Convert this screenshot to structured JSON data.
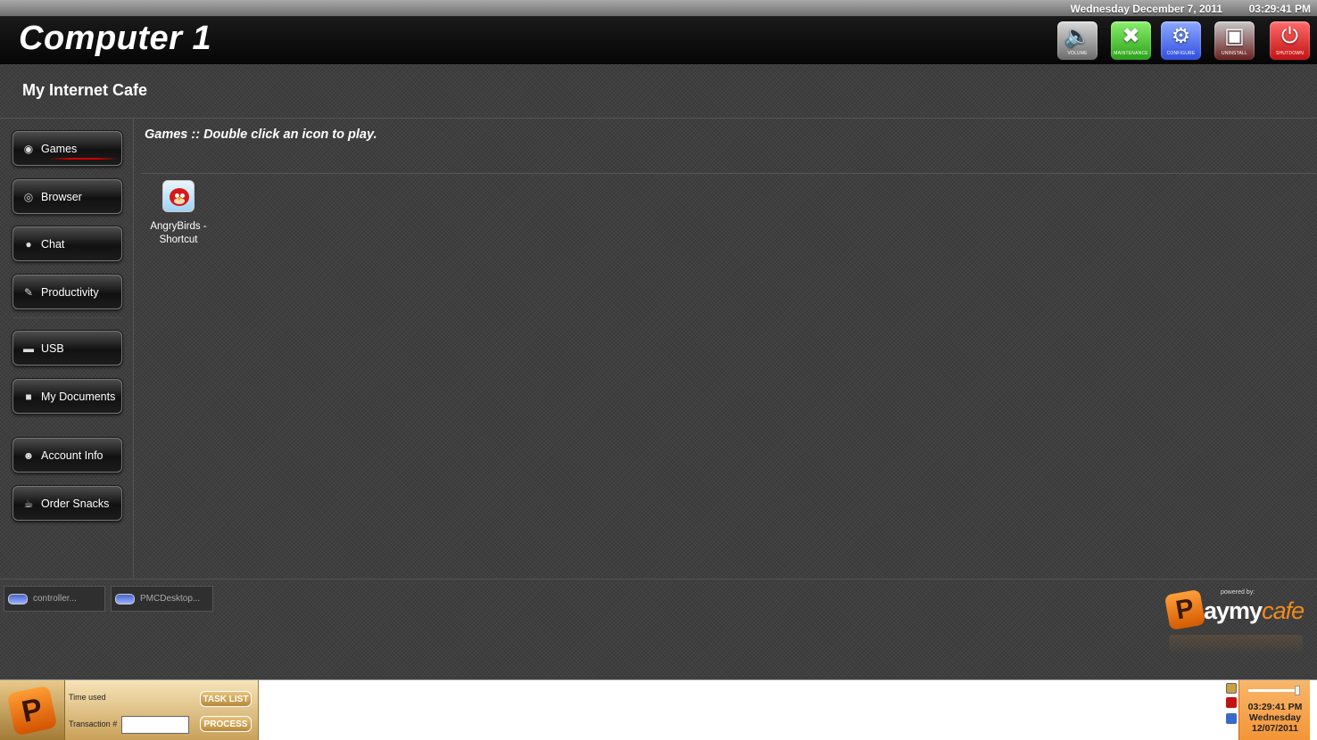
{
  "top_bar": {
    "date": "Wednesday December 7, 2011",
    "time": "03:29:41 PM"
  },
  "header": {
    "computer_name": "Computer 1",
    "tools": [
      {
        "label": "VOLUME",
        "icon": "volume-icon",
        "color": "#9a9a9a"
      },
      {
        "label": "MAINTENANCE",
        "icon": "wrench-icon",
        "color": "#3fbf2a"
      },
      {
        "label": "CONFIGURE",
        "icon": "gears-icon",
        "color": "#3a5cf0"
      },
      {
        "label": "UNINSTALL",
        "icon": "uninstall-icon",
        "color": "#8a3030"
      },
      {
        "label": "SHUTDOWN",
        "icon": "power-icon",
        "color": "#e01d1d"
      }
    ]
  },
  "cafe_name": "My Internet Cafe",
  "sidebar": {
    "items": [
      {
        "label": "Games",
        "icon": "games-icon",
        "active": true
      },
      {
        "label": "Browser",
        "icon": "globe-icon"
      },
      {
        "label": "Chat",
        "icon": "chat-bubble-icon"
      },
      {
        "label": "Productivity",
        "icon": "document-edit-icon"
      },
      {
        "label": "USB",
        "icon": "usb-drive-icon"
      },
      {
        "label": "My Documents",
        "icon": "folder-icon"
      },
      {
        "label": "Account Info",
        "icon": "user-icon"
      },
      {
        "label": "Order Snacks",
        "icon": "drink-cup-icon"
      }
    ]
  },
  "main": {
    "title": "Games :: Double click an icon to play.",
    "icons": [
      {
        "label": "AngryBirds - Shortcut",
        "icon": "angry-birds-icon"
      }
    ]
  },
  "taskbar": {
    "items": [
      {
        "label": "controller...",
        "icon": "app-window-icon"
      },
      {
        "label": "PMCDesktop...",
        "icon": "app-window-icon"
      }
    ]
  },
  "branding": {
    "powered_by": "powered by:",
    "logo_letter": "P",
    "logo_text": "aymy",
    "logo_text_cafe": "cafe",
    "accent": "#f08a1e"
  },
  "bottom_bar": {
    "time_used_label": "Time used",
    "transaction_label": "Transaction #",
    "transaction_value": "",
    "task_list_button": "TASK LIST",
    "process_button": "PROCESS",
    "clock_time": "03:29:41 PM",
    "clock_day": "Wednesday",
    "clock_date": "12/07/2011"
  }
}
